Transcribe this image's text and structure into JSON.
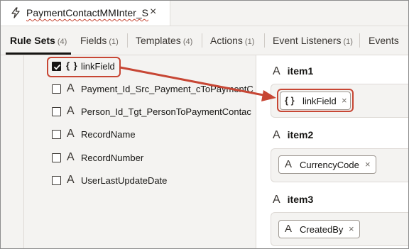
{
  "tab": {
    "title": "PaymentContactMMInter_S",
    "close_glyph": "×",
    "icon": "bolt-icon"
  },
  "nav": {
    "tabs": [
      {
        "label": "Rule Sets",
        "count": "(4)",
        "active": true
      },
      {
        "label": "Fields",
        "count": "(1)"
      },
      {
        "label": "Templates",
        "count": "(4)"
      },
      {
        "label": "Actions",
        "count": "(1)"
      },
      {
        "label": "Event Listeners",
        "count": "(1)"
      },
      {
        "label": "Events",
        "count": ""
      }
    ]
  },
  "fields": [
    {
      "label": "linkField",
      "type_icon": "{ }",
      "checked": true
    },
    {
      "label": "Payment_Id_Src_Payment_cToPaymentC",
      "type_icon": "A",
      "checked": false
    },
    {
      "label": "Person_Id_Tgt_PersonToPaymentContac",
      "type_icon": "A",
      "checked": false
    },
    {
      "label": "RecordName",
      "type_icon": "A",
      "checked": false
    },
    {
      "label": "RecordNumber",
      "type_icon": "A",
      "checked": false
    },
    {
      "label": "UserLastUpdateDate",
      "type_icon": "A",
      "checked": false
    }
  ],
  "items": [
    {
      "label": "item1",
      "icon": "A",
      "chip": {
        "icon": "{ }",
        "label": "linkField",
        "remove": "×"
      }
    },
    {
      "label": "item2",
      "icon": "A",
      "chip": {
        "icon": "A",
        "label": "CurrencyCode",
        "remove": "×"
      }
    },
    {
      "label": "item3",
      "icon": "A",
      "chip": {
        "icon": "A",
        "label": "CreatedBy",
        "remove": "×"
      }
    }
  ],
  "colors": {
    "highlight": "#c74634",
    "text": "#161513",
    "panel": "#f4f3f1"
  }
}
